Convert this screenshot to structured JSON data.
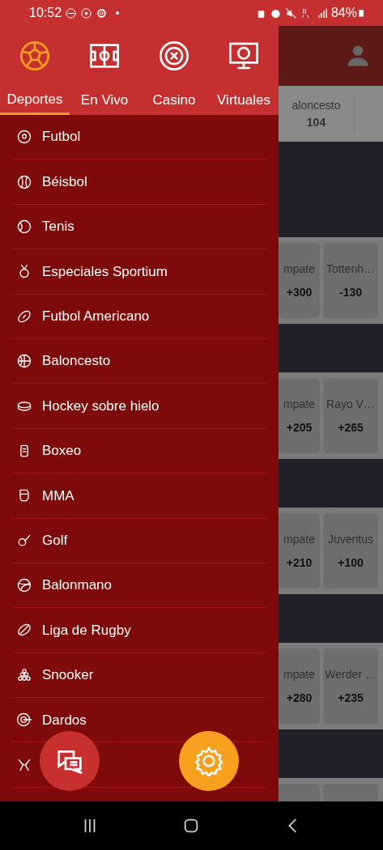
{
  "status_bar": {
    "time": "10:52",
    "battery": "84%"
  },
  "tabs": [
    {
      "label": "Deportes",
      "selected": true
    },
    {
      "label": "En Vivo",
      "selected": false
    },
    {
      "label": "Casino",
      "selected": false
    },
    {
      "label": "Virtuales",
      "selected": false
    }
  ],
  "sports": [
    {
      "label": "Futbol"
    },
    {
      "label": "Béisbol"
    },
    {
      "label": "Tenis"
    },
    {
      "label": "Especiales Sportium"
    },
    {
      "label": "Futbol Americano"
    },
    {
      "label": "Baloncesto"
    },
    {
      "label": "Hockey sobre hielo"
    },
    {
      "label": "Boxeo"
    },
    {
      "label": "MMA"
    },
    {
      "label": "Golf"
    },
    {
      "label": "Balonmano"
    },
    {
      "label": "Liga de Rugby"
    },
    {
      "label": "Snooker"
    },
    {
      "label": "Dardos"
    },
    {
      "kind": "covered"
    }
  ],
  "background": {
    "category_strip": [
      {
        "label": "aloncesto",
        "count": "104"
      }
    ],
    "matches": [
      {
        "odds": [
          {
            "label": "mpate",
            "price": "+300"
          },
          {
            "label": "Tottenh…",
            "price": "-130"
          }
        ]
      },
      {
        "odds": [
          {
            "label": "mpate",
            "price": "+205"
          },
          {
            "label": "Rayo V…",
            "price": "+265"
          }
        ]
      },
      {
        "odds": [
          {
            "label": "mpate",
            "price": "+210"
          },
          {
            "label": "Juventus",
            "price": "+100"
          }
        ]
      },
      {
        "odds": [
          {
            "label": "mpate",
            "price": "+280"
          },
          {
            "label": "Werder …",
            "price": "+235"
          }
        ]
      },
      {
        "kind": "cut_off"
      }
    ]
  }
}
